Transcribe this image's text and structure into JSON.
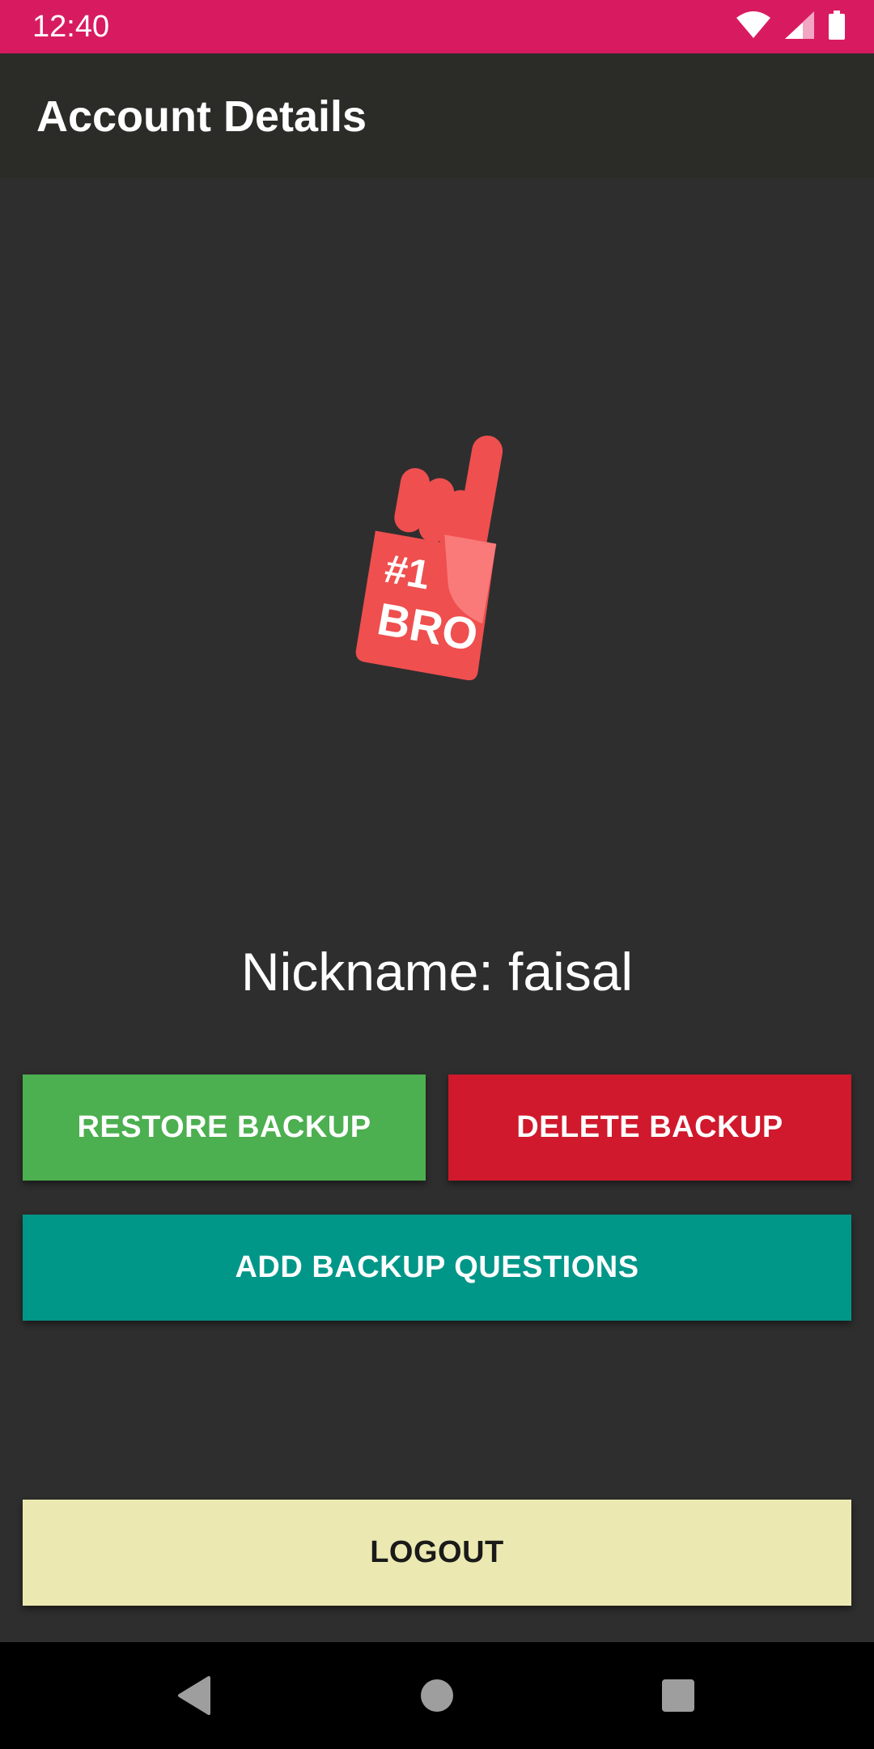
{
  "status_bar": {
    "time": "12:40",
    "icons": [
      "wifi-icon",
      "cell-signal-icon",
      "battery-icon"
    ],
    "color": "#d81b60"
  },
  "app_bar": {
    "title": "Account Details"
  },
  "profile": {
    "avatar_icon": "foam-finger-icon",
    "avatar_text_line1": "#1",
    "avatar_text_line2": "BRO",
    "nickname": "Nickname: faisal"
  },
  "buttons": {
    "restore_label": "RESTORE BACKUP",
    "delete_label": "DELETE BACKUP",
    "questions_label": "ADD BACKUP QUESTIONS",
    "logout_label": "LOGOUT"
  },
  "colors": {
    "restore": "#4caf50",
    "delete": "#d0192c",
    "questions": "#009688",
    "logout": "#ebe9b1",
    "background": "#2e2e2e"
  },
  "nav_bar": {
    "icons": [
      "back-icon",
      "home-icon",
      "recents-icon"
    ]
  }
}
